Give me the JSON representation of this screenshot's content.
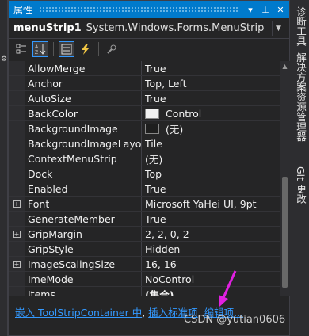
{
  "panel": {
    "title": "属性",
    "pin_icon": "pin-icon",
    "close_icon": "close-icon"
  },
  "object": {
    "name": "menuStrip1",
    "type": "System.Windows.Forms.MenuStrip"
  },
  "properties": [
    {
      "name": "AllowMerge",
      "value": "True",
      "expandable": false
    },
    {
      "name": "Anchor",
      "value": "Top, Left",
      "expandable": false
    },
    {
      "name": "AutoSize",
      "value": "True",
      "expandable": false
    },
    {
      "name": "BackColor",
      "value": "Control",
      "expandable": false,
      "swatch": "#f0f0f0"
    },
    {
      "name": "BackgroundImage",
      "value": "(无)",
      "expandable": false,
      "swatch": "#1e1e1e"
    },
    {
      "name": "BackgroundImageLayou",
      "value": "Tile",
      "expandable": false
    },
    {
      "name": "ContextMenuStrip",
      "value": "(无)",
      "expandable": false
    },
    {
      "name": "Dock",
      "value": "Top",
      "expandable": false
    },
    {
      "name": "Enabled",
      "value": "True",
      "expandable": false
    },
    {
      "name": "Font",
      "value": "Microsoft YaHei UI, 9pt",
      "expandable": true
    },
    {
      "name": "GenerateMember",
      "value": "True",
      "expandable": false
    },
    {
      "name": "GripMargin",
      "value": "2, 2, 0, 2",
      "expandable": true
    },
    {
      "name": "GripStyle",
      "value": "Hidden",
      "expandable": false
    },
    {
      "name": "ImageScalingSize",
      "value": "16, 16",
      "expandable": true
    },
    {
      "name": "ImeMode",
      "value": "NoControl",
      "expandable": false
    },
    {
      "name": "Items",
      "value": "(集合)",
      "expandable": false,
      "bold": true
    }
  ],
  "commands": {
    "link1": "嵌入 ToolStripContainer 中",
    "link2": "插入标准项",
    "link3": "编辑项...",
    "separator": ", "
  },
  "side_tabs": {
    "tab1": "诊断工具",
    "tab2": "解决方案资源管理器",
    "tab3": "Git 更改"
  },
  "watermark": "CSDN @yutian0606",
  "colors": {
    "title_bar": "#007acc",
    "link": "#3399ff",
    "arrow": "#e020e0"
  }
}
